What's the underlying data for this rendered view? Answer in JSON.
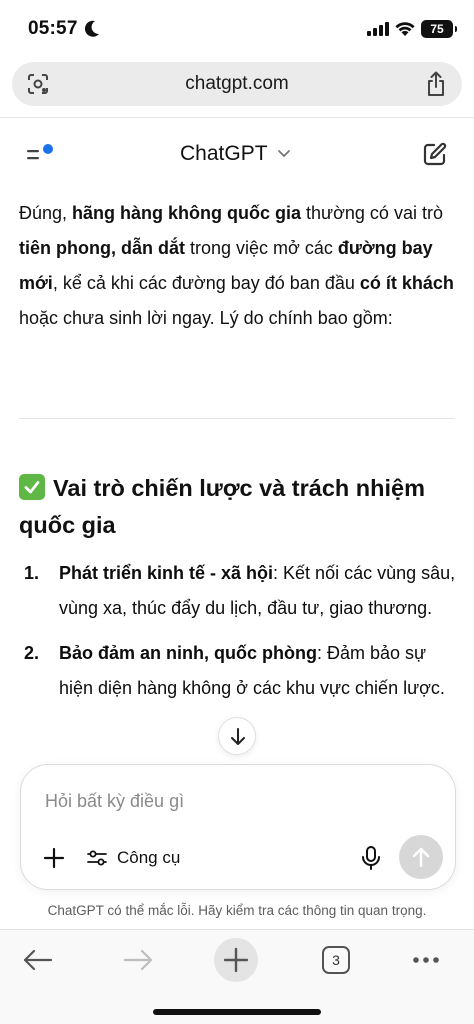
{
  "status_bar": {
    "time": "05:57",
    "battery": "75"
  },
  "browser": {
    "url": "chatgpt.com"
  },
  "header": {
    "title": "ChatGPT"
  },
  "message": {
    "intro": [
      {
        "t": "Đúng, ",
        "b": false
      },
      {
        "t": "hãng hàng không quốc gia",
        "b": true
      },
      {
        "t": " thường có vai trò ",
        "b": false
      },
      {
        "t": "tiên phong, dẫn dắt",
        "b": true
      },
      {
        "t": " trong việc mở các ",
        "b": false
      },
      {
        "t": "đường bay mới",
        "b": true
      },
      {
        "t": ", kể cả khi các đường bay đó ban đầu ",
        "b": false
      },
      {
        "t": "có ít khách",
        "b": true
      },
      {
        "t": " hoặc chưa sinh lời ngay. Lý do chính bao gồm:",
        "b": false
      }
    ],
    "heading": "Vai trò chiến lược và trách nhiệm quốc gia",
    "items": [
      {
        "num": "1.",
        "bold": "Phát triển kinh tế - xã hội",
        "text": ": Kết nối các vùng sâu, vùng xa, thúc đẩy du lịch, đầu tư, giao thương."
      },
      {
        "num": "2.",
        "bold": "Bảo đảm an ninh, quốc phòng",
        "text": ": Đảm bảo sự hiện diện hàng không ở các khu vực chiến lược."
      }
    ]
  },
  "composer": {
    "placeholder": "Hỏi bất kỳ điều gì",
    "tools_label": "Công cụ"
  },
  "disclaimer": "ChatGPT có thể mắc lỗi. Hãy kiểm tra các thông tin quan trọng.",
  "toolbar": {
    "tab_count": "3"
  },
  "colors": {
    "accent_dot": "#1a73e8",
    "check_green": "#5fb846",
    "send_disabled": "#d7d7d7"
  },
  "icons": [
    "moon-icon",
    "signal-icon",
    "wifi-icon",
    "lens-icon",
    "share-icon",
    "menu-icon",
    "chevron-down-icon",
    "edit-icon",
    "check-icon",
    "arrow-down-icon",
    "plus-icon",
    "tools-icon",
    "mic-icon",
    "send-icon",
    "back-icon",
    "forward-icon",
    "new-tab-icon",
    "more-icon"
  ]
}
